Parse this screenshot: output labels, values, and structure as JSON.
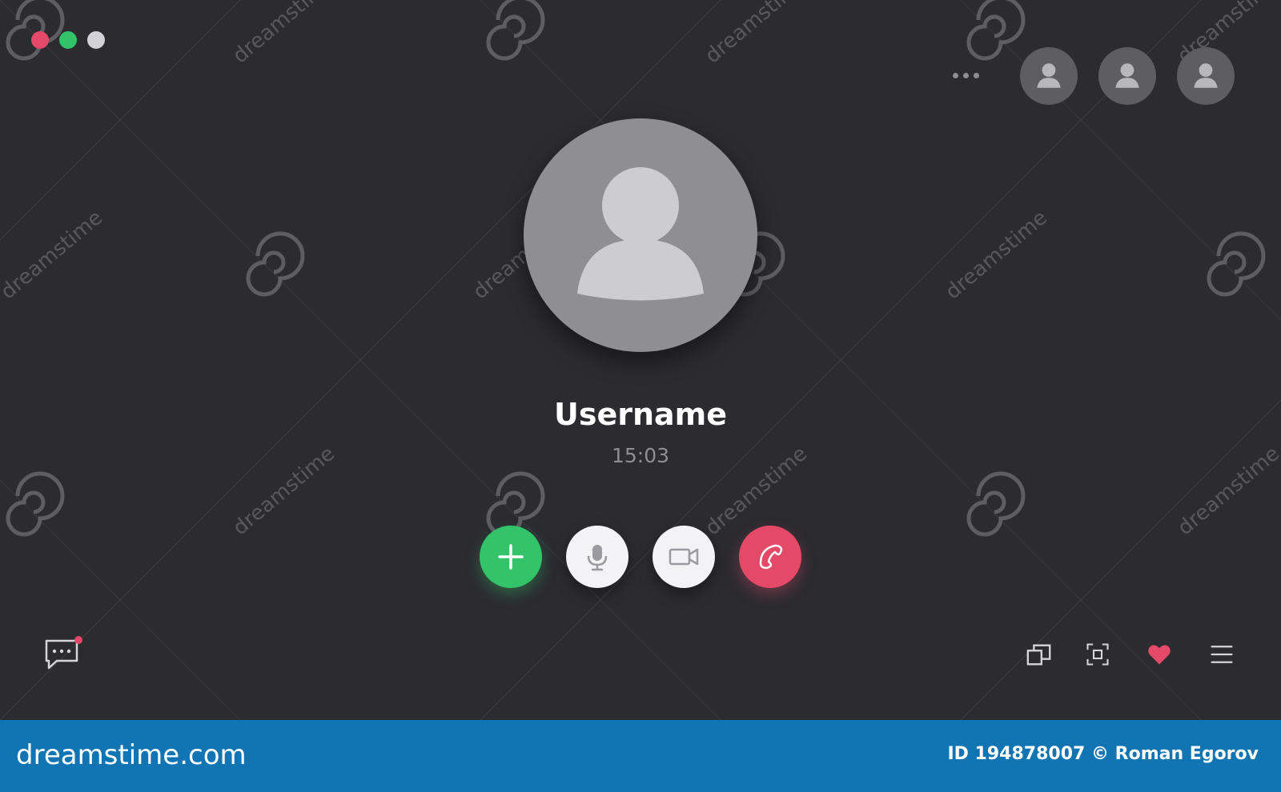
{
  "call": {
    "username": "Username",
    "duration": "15:03"
  },
  "icons": {
    "window_controls": [
      "close-dot",
      "maximize-dot",
      "minimize-dot"
    ],
    "top_right": [
      "more-dots-icon",
      "participant-avatar-icon",
      "participant-avatar-icon",
      "participant-avatar-icon"
    ],
    "call_controls": [
      "plus-icon",
      "microphone-icon",
      "video-camera-icon",
      "phone-hangup-icon"
    ],
    "bottom_left": [
      "chat-bubble-icon"
    ],
    "bottom_right": [
      "picture-in-picture-icon",
      "fullscreen-icon",
      "heart-icon",
      "menu-icon"
    ]
  },
  "colors": {
    "background": "#2b2b30",
    "green": "#33c46a",
    "red": "#e44a68",
    "avatar": "#8f8f93",
    "footer": "#1275b3"
  },
  "watermark": {
    "text": "dreamstime"
  },
  "footer": {
    "brand": "dreamstime.com",
    "credit": "ID 194878007 © Roman Egorov"
  }
}
